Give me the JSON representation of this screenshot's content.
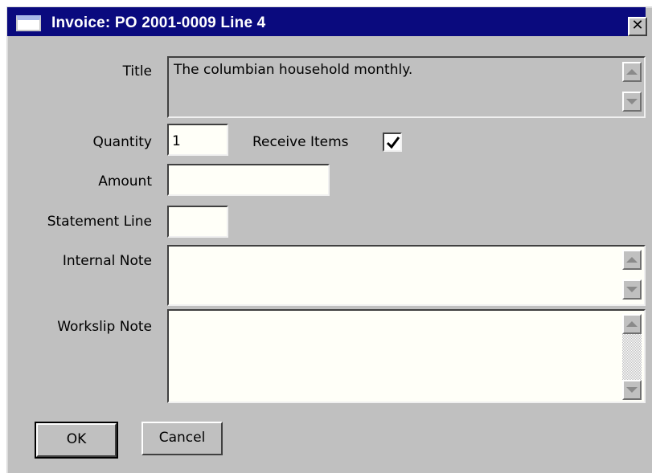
{
  "window": {
    "title": "Invoice: PO 2001-0009 Line 4",
    "close_label": "✕"
  },
  "form": {
    "title": {
      "label": "Title",
      "value": "The columbian household monthly."
    },
    "quantity": {
      "label": "Quantity",
      "value": "1"
    },
    "receive_items": {
      "label": "Receive Items",
      "checked": true
    },
    "amount": {
      "label": "Amount",
      "value": ""
    },
    "statement_line": {
      "label": "Statement Line",
      "value": ""
    },
    "internal_note": {
      "label": "Internal Note",
      "value": ""
    },
    "workslip_note": {
      "label": "Workslip Note",
      "value": ""
    }
  },
  "buttons": {
    "ok": "OK",
    "cancel": "Cancel"
  },
  "colors": {
    "titlebar": "#0a0a7e",
    "dialog_bg": "#c0c0c0",
    "field_bg": "#fffff8"
  }
}
